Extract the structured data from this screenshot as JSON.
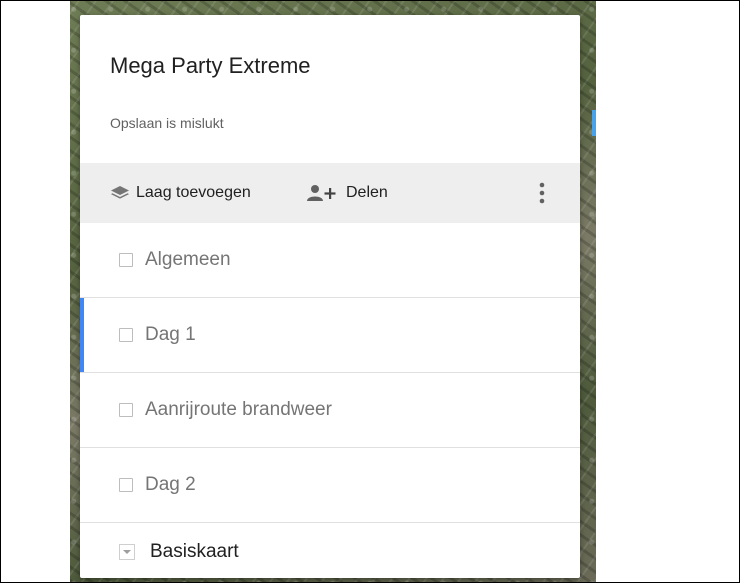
{
  "map": {
    "title": "Mega Party Extreme",
    "status": "Opslaan is mislukt"
  },
  "toolbar": {
    "add_layer_label": "Laag toevoegen",
    "add_layer_icon": "layers-icon",
    "share_label": "Delen",
    "share_icon": "add-person-icon",
    "more_icon": "more-vert-icon"
  },
  "layers": [
    {
      "label": "Algemeen",
      "checked": false,
      "active": false
    },
    {
      "label": "Dag 1",
      "checked": false,
      "active": true
    },
    {
      "label": "Aanrijroute brandweer",
      "checked": false,
      "active": false
    },
    {
      "label": "Dag 2",
      "checked": false,
      "active": false
    }
  ],
  "base_map": {
    "label": "Basiskaart",
    "icon": "chevron-down-icon"
  },
  "colors": {
    "active_accent": "#4285f4",
    "toolbar_bg": "#eeeeee",
    "icon_gray": "#757575"
  }
}
